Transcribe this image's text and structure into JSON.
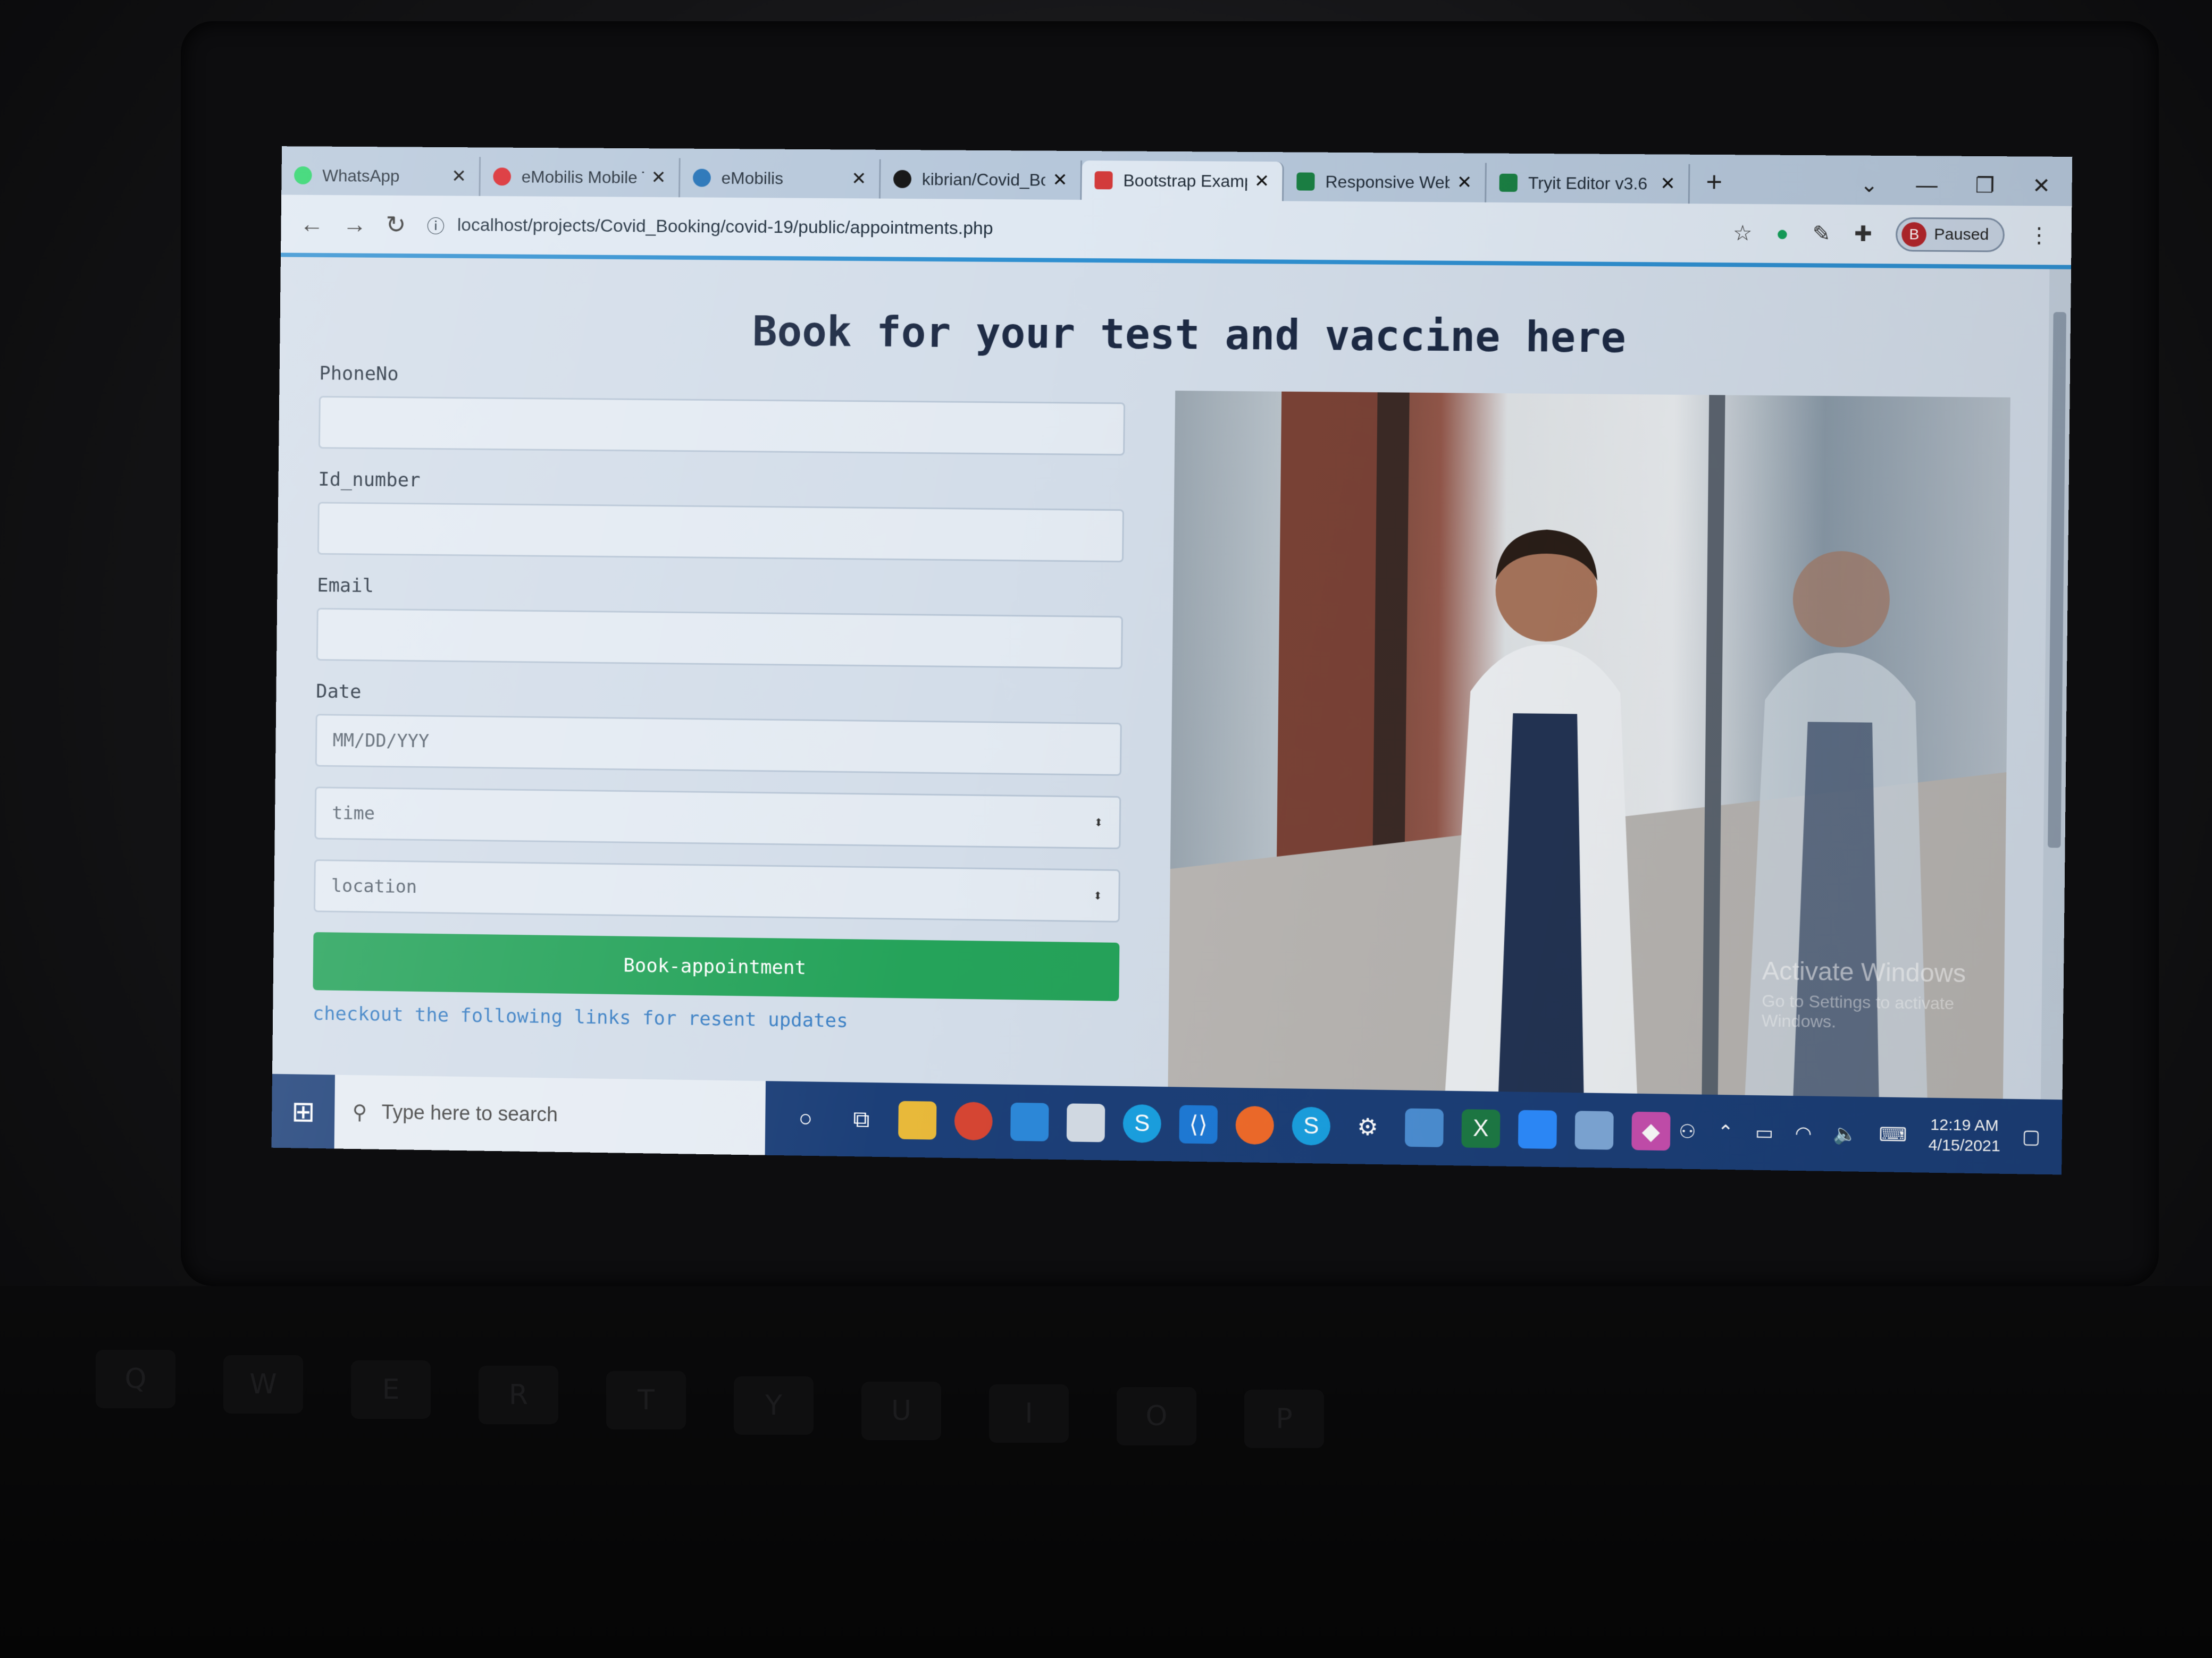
{
  "browser": {
    "tabs": [
      {
        "title": "WhatsApp",
        "icon": "whatsapp-icon",
        "color": "#25d366"
      },
      {
        "title": "eMobilis Mobile T",
        "icon": "emobilis-icon",
        "color": "#d9262c"
      },
      {
        "title": "eMobilis",
        "icon": "emobilis-globe-icon",
        "color": "#1f6fb5"
      },
      {
        "title": "kibrian/Covid_Bo",
        "icon": "github-icon",
        "color": "#111111"
      },
      {
        "title": "Bootstrap Exampl",
        "icon": "bootstrap-icon",
        "color": "#d33b3b",
        "active": true
      },
      {
        "title": "Responsive Web I",
        "icon": "w3schools-icon",
        "color": "#1a7f43"
      },
      {
        "title": "Tryit Editor v3.6",
        "icon": "w3schools-icon",
        "color": "#1a7f43"
      }
    ],
    "new_tab": "+",
    "url": "localhost/projects/Covid_Booking/covid-19/public/appointments.php",
    "profile_initial": "B",
    "profile_status": "Paused"
  },
  "page": {
    "title": "Book for your test and vaccine here",
    "form": {
      "phone_label": "PhoneNo",
      "id_label": "Id_number",
      "email_label": "Email",
      "date_label": "Date",
      "date_placeholder": "MM/DD/YYY",
      "time_select": "time",
      "location_select": "location",
      "submit_label": "Book-appointment",
      "links_text": "checkout the following links for resent updates"
    },
    "watermark_line1": "Activate Windows",
    "watermark_line2": "Go to Settings to activate Windows."
  },
  "taskbar": {
    "search_placeholder": "Type here to search",
    "time": "12:19 AM",
    "date": "4/15/2021"
  },
  "colors": {
    "submit_button": "#25a35a",
    "taskbar": "#1c3f78",
    "link": "#3a7fc4"
  }
}
